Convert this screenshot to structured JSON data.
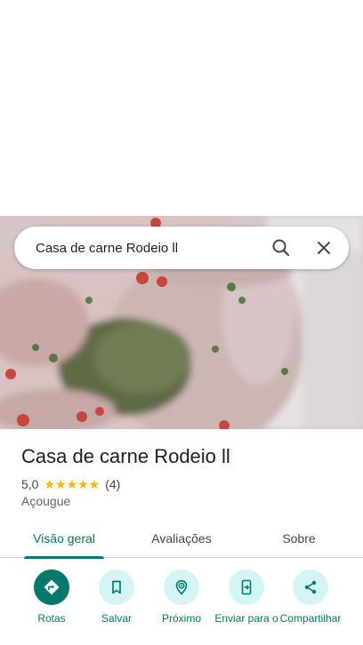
{
  "search": {
    "query": "Casa de carne Rodeio ll",
    "search_icon": "search-icon",
    "close_icon": "close-icon"
  },
  "place": {
    "photo": "meat-cut-photo",
    "name": "Casa de carne Rodeio ll",
    "rating": "5,0",
    "stars": "★★★★★",
    "review_count": "(4)",
    "category": "Açougue"
  },
  "tabs": [
    {
      "label": "Visão geral",
      "active": true
    },
    {
      "label": "Avaliações",
      "active": false
    },
    {
      "label": "Sobre",
      "active": false
    }
  ],
  "actions": [
    {
      "label": "Rotas",
      "icon": "directions-icon"
    },
    {
      "label": "Salvar",
      "icon": "bookmark-icon"
    },
    {
      "label": "Próximo",
      "icon": "nearby-icon"
    },
    {
      "label": "Enviar para o",
      "icon": "send-to-phone-icon"
    },
    {
      "label": "Compartilhar",
      "icon": "share-icon"
    }
  ],
  "colors": {
    "accent": "#00796b",
    "action_bg": "#d5f4f6",
    "star": "#f4b400"
  }
}
